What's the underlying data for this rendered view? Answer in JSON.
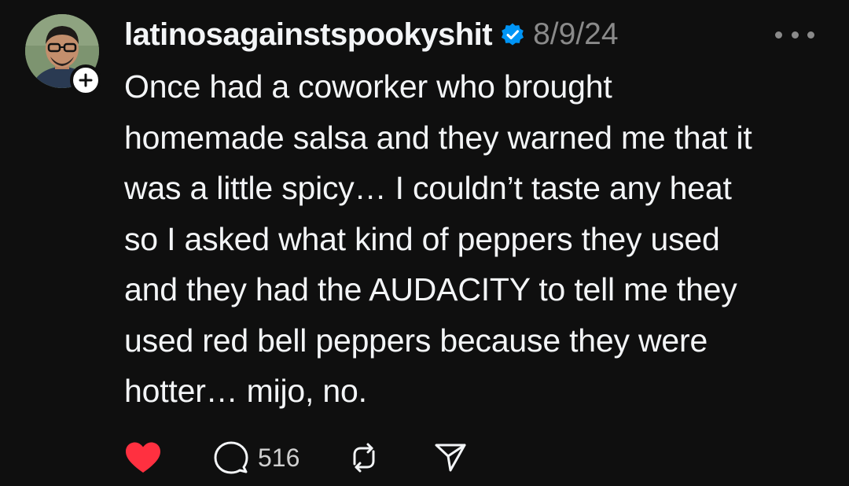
{
  "post": {
    "username": "latinosagainstspookyshit",
    "date": "8/9/24",
    "text": "Once had a coworker who brought\nhomemade salsa and they warned me that it\nwas a little spicy… I couldn’t taste any heat\nso I asked what kind of peppers they used\nand they had the AUDACITY to tell me they\nused red bell peppers because they were\nhotter… mijo, no.",
    "reply_count": "516",
    "liked": true
  },
  "icons": {
    "verified": "verified-badge-icon",
    "follow": "plus-icon",
    "more": "more-horizontal-icon",
    "like": "heart-icon",
    "reply": "comment-bubble-icon",
    "repost": "repost-icon",
    "share": "send-icon"
  },
  "colors": {
    "background": "#0f0f0f",
    "text": "#f3f5f7",
    "muted": "#8a8a8a",
    "like": "#ff3040",
    "verified": "#0095f6"
  }
}
